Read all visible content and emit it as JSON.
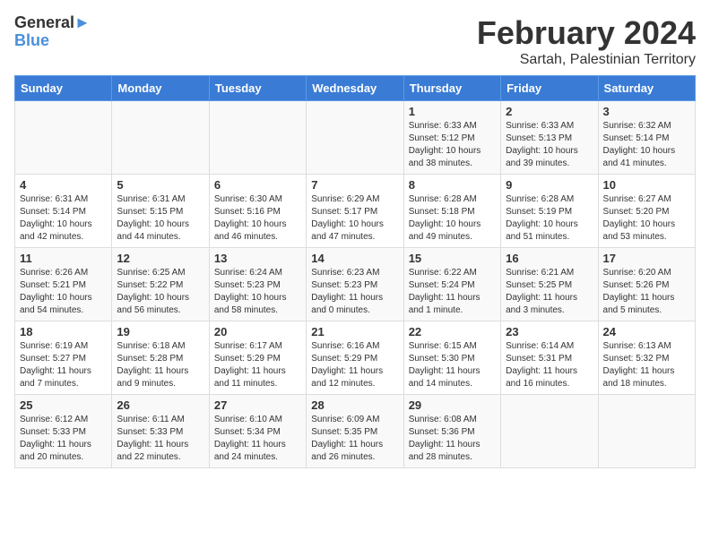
{
  "logo": {
    "line1": "General",
    "line2": "Blue"
  },
  "title": "February 2024",
  "location": "Sartah, Palestinian Territory",
  "days_of_week": [
    "Sunday",
    "Monday",
    "Tuesday",
    "Wednesday",
    "Thursday",
    "Friday",
    "Saturday"
  ],
  "weeks": [
    [
      {
        "day": "",
        "info": ""
      },
      {
        "day": "",
        "info": ""
      },
      {
        "day": "",
        "info": ""
      },
      {
        "day": "",
        "info": ""
      },
      {
        "day": "1",
        "info": "Sunrise: 6:33 AM\nSunset: 5:12 PM\nDaylight: 10 hours and 38 minutes."
      },
      {
        "day": "2",
        "info": "Sunrise: 6:33 AM\nSunset: 5:13 PM\nDaylight: 10 hours and 39 minutes."
      },
      {
        "day": "3",
        "info": "Sunrise: 6:32 AM\nSunset: 5:14 PM\nDaylight: 10 hours and 41 minutes."
      }
    ],
    [
      {
        "day": "4",
        "info": "Sunrise: 6:31 AM\nSunset: 5:14 PM\nDaylight: 10 hours and 42 minutes."
      },
      {
        "day": "5",
        "info": "Sunrise: 6:31 AM\nSunset: 5:15 PM\nDaylight: 10 hours and 44 minutes."
      },
      {
        "day": "6",
        "info": "Sunrise: 6:30 AM\nSunset: 5:16 PM\nDaylight: 10 hours and 46 minutes."
      },
      {
        "day": "7",
        "info": "Sunrise: 6:29 AM\nSunset: 5:17 PM\nDaylight: 10 hours and 47 minutes."
      },
      {
        "day": "8",
        "info": "Sunrise: 6:28 AM\nSunset: 5:18 PM\nDaylight: 10 hours and 49 minutes."
      },
      {
        "day": "9",
        "info": "Sunrise: 6:28 AM\nSunset: 5:19 PM\nDaylight: 10 hours and 51 minutes."
      },
      {
        "day": "10",
        "info": "Sunrise: 6:27 AM\nSunset: 5:20 PM\nDaylight: 10 hours and 53 minutes."
      }
    ],
    [
      {
        "day": "11",
        "info": "Sunrise: 6:26 AM\nSunset: 5:21 PM\nDaylight: 10 hours and 54 minutes."
      },
      {
        "day": "12",
        "info": "Sunrise: 6:25 AM\nSunset: 5:22 PM\nDaylight: 10 hours and 56 minutes."
      },
      {
        "day": "13",
        "info": "Sunrise: 6:24 AM\nSunset: 5:23 PM\nDaylight: 10 hours and 58 minutes."
      },
      {
        "day": "14",
        "info": "Sunrise: 6:23 AM\nSunset: 5:23 PM\nDaylight: 11 hours and 0 minutes."
      },
      {
        "day": "15",
        "info": "Sunrise: 6:22 AM\nSunset: 5:24 PM\nDaylight: 11 hours and 1 minute."
      },
      {
        "day": "16",
        "info": "Sunrise: 6:21 AM\nSunset: 5:25 PM\nDaylight: 11 hours and 3 minutes."
      },
      {
        "day": "17",
        "info": "Sunrise: 6:20 AM\nSunset: 5:26 PM\nDaylight: 11 hours and 5 minutes."
      }
    ],
    [
      {
        "day": "18",
        "info": "Sunrise: 6:19 AM\nSunset: 5:27 PM\nDaylight: 11 hours and 7 minutes."
      },
      {
        "day": "19",
        "info": "Sunrise: 6:18 AM\nSunset: 5:28 PM\nDaylight: 11 hours and 9 minutes."
      },
      {
        "day": "20",
        "info": "Sunrise: 6:17 AM\nSunset: 5:29 PM\nDaylight: 11 hours and 11 minutes."
      },
      {
        "day": "21",
        "info": "Sunrise: 6:16 AM\nSunset: 5:29 PM\nDaylight: 11 hours and 12 minutes."
      },
      {
        "day": "22",
        "info": "Sunrise: 6:15 AM\nSunset: 5:30 PM\nDaylight: 11 hours and 14 minutes."
      },
      {
        "day": "23",
        "info": "Sunrise: 6:14 AM\nSunset: 5:31 PM\nDaylight: 11 hours and 16 minutes."
      },
      {
        "day": "24",
        "info": "Sunrise: 6:13 AM\nSunset: 5:32 PM\nDaylight: 11 hours and 18 minutes."
      }
    ],
    [
      {
        "day": "25",
        "info": "Sunrise: 6:12 AM\nSunset: 5:33 PM\nDaylight: 11 hours and 20 minutes."
      },
      {
        "day": "26",
        "info": "Sunrise: 6:11 AM\nSunset: 5:33 PM\nDaylight: 11 hours and 22 minutes."
      },
      {
        "day": "27",
        "info": "Sunrise: 6:10 AM\nSunset: 5:34 PM\nDaylight: 11 hours and 24 minutes."
      },
      {
        "day": "28",
        "info": "Sunrise: 6:09 AM\nSunset: 5:35 PM\nDaylight: 11 hours and 26 minutes."
      },
      {
        "day": "29",
        "info": "Sunrise: 6:08 AM\nSunset: 5:36 PM\nDaylight: 11 hours and 28 minutes."
      },
      {
        "day": "",
        "info": ""
      },
      {
        "day": "",
        "info": ""
      }
    ]
  ]
}
